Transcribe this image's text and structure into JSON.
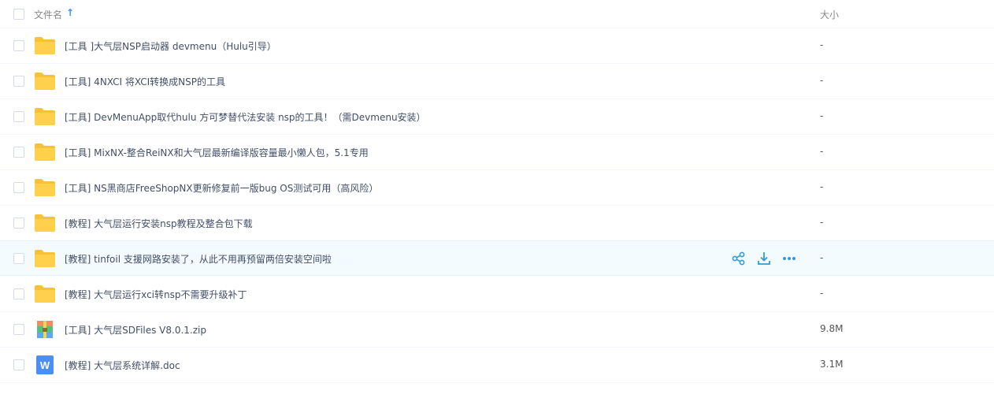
{
  "header": {
    "name_label": "文件名",
    "size_label": "大小",
    "sort_arrow": "↑"
  },
  "files": [
    {
      "type": "folder",
      "name": "[工具 ]大气层NSP启动器 devmenu（Hulu引导）",
      "size": "-"
    },
    {
      "type": "folder",
      "name": "[工具] 4NXCI 将XCI转换成NSP的工具",
      "size": "-"
    },
    {
      "type": "folder",
      "name": "[工具] DevMenuApp取代hulu 方可梦替代法安装 nsp的工具！（需Devmenu安装）",
      "size": "-"
    },
    {
      "type": "folder",
      "name": "[工具] MixNX-整合ReiNX和大气层最新编译版容量最小懒人包，5.1专用",
      "size": "-"
    },
    {
      "type": "folder",
      "name": "[工具] NS黑商店FreeShopNX更新修复前一版bug OS测试可用（高风险）",
      "size": "-"
    },
    {
      "type": "folder",
      "name": "[教程] 大气层运行安装nsp教程及整合包下载",
      "size": "-"
    },
    {
      "type": "folder",
      "name": "[教程] tinfoil 支援网路安装了，从此不用再预留两倍安装空间啦",
      "size": "-"
    },
    {
      "type": "folder",
      "name": "[教程] 大气层运行xci转nsp不需要升级补丁",
      "size": "-"
    },
    {
      "type": "zip",
      "name": "[工具] 大气层SDFiles V8.0.1.zip",
      "size": "9.8M"
    },
    {
      "type": "doc",
      "name": "[教程] 大气层系统详解.doc",
      "size": "3.1M"
    }
  ],
  "hover_row_index": 6,
  "row_actions": [
    "share-icon",
    "download-icon",
    "more-icon"
  ],
  "colors": {
    "folder": "#ffd04b",
    "folder_tab": "#f7c23a",
    "accent": "#3b8cff",
    "action_icon": "#2f9bd8",
    "doc_blue": "#4b8ff2"
  }
}
